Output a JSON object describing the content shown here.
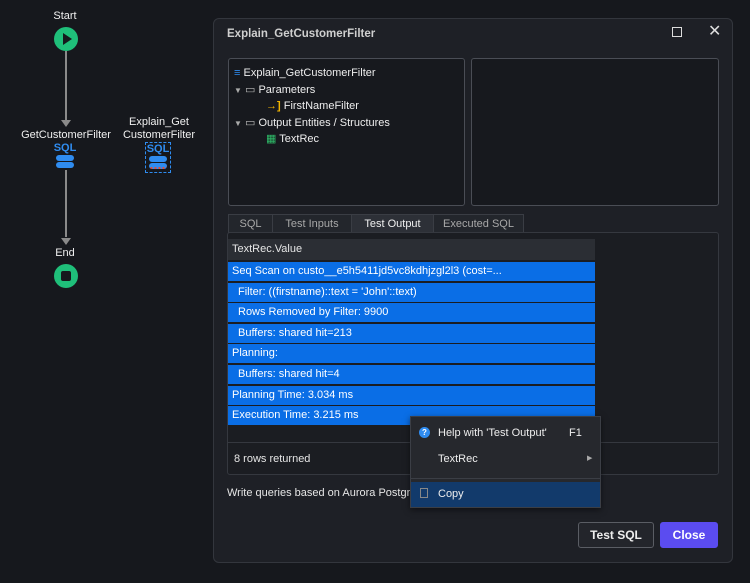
{
  "flow": {
    "start": "Start",
    "node1": "GetCustomerFilter",
    "node2_line1": "Explain_Get",
    "node2_line2": "CustomerFilter",
    "end": "End",
    "sql_label": "SQL"
  },
  "dialog": {
    "title": "Explain_GetCustomerFilter",
    "tree": {
      "root": "Explain_GetCustomerFilter",
      "parameters": "Parameters",
      "param1": "FirstNameFilter",
      "outputs": "Output Entities / Structures",
      "output1": "TextRec"
    },
    "tabs": [
      "SQL",
      "Test Inputs",
      "Test Output",
      "Executed SQL"
    ],
    "active_tab": "Test Output",
    "table": {
      "header": "TextRec.Value",
      "rows": [
        "Seq Scan on custo__e5h5411jd5vc8kdhjzgl2l3 (cost=...",
        "Filter: ((firstname)::text = 'John'::text)",
        "Rows Removed by Filter: 9900",
        "Buffers: shared hit=213",
        "Planning:",
        "Buffers: shared hit=4",
        "Planning Time: 3.034 ms",
        "Execution Time: 3.215 ms"
      ],
      "footer": "8 rows returned"
    },
    "hint": "Write queries based on Aurora PostgreS",
    "buttons": {
      "test": "Test SQL",
      "close": "Close"
    }
  },
  "context_menu": {
    "help": "Help with 'Test Output'",
    "help_shortcut": "F1",
    "textrec": "TextRec",
    "copy": "Copy"
  },
  "colors": {
    "accent": "#5b4cf0",
    "selection": "#0a6ee6",
    "node": "#1fbf7a"
  }
}
